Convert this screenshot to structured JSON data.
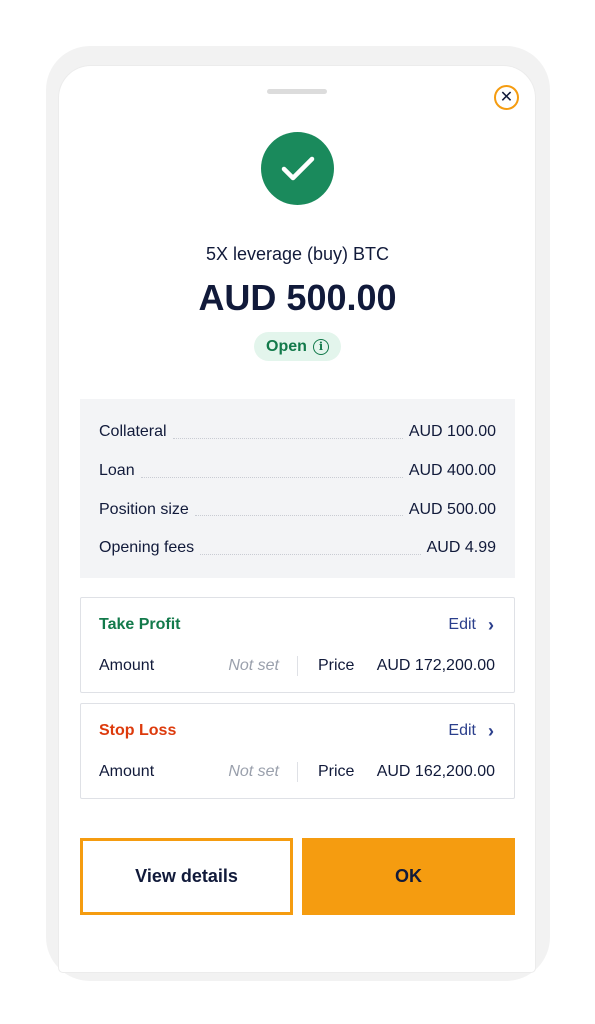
{
  "header": {
    "close_icon": "close-icon",
    "success_icon": "checkmark-icon"
  },
  "trade": {
    "subtitle": "5X leverage (buy) BTC",
    "amount": "AUD 500.00",
    "status": "Open",
    "status_icon": "info-icon"
  },
  "summary": {
    "rows": [
      {
        "label": "Collateral",
        "value": "AUD 100.00"
      },
      {
        "label": "Loan",
        "value": "AUD 400.00"
      },
      {
        "label": "Position size",
        "value": "AUD 500.00"
      },
      {
        "label": "Opening fees",
        "value": "AUD 4.99"
      }
    ]
  },
  "take_profit": {
    "title": "Take Profit",
    "edit_label": "Edit",
    "amount_label": "Amount",
    "amount_value": "Not set",
    "price_label": "Price",
    "price_value": "AUD 172,200.00"
  },
  "stop_loss": {
    "title": "Stop Loss",
    "edit_label": "Edit",
    "amount_label": "Amount",
    "amount_value": "Not set",
    "price_label": "Price",
    "price_value": "AUD 162,200.00"
  },
  "actions": {
    "view_details_label": "View details",
    "ok_label": "OK"
  },
  "colors": {
    "accent": "#f59c10",
    "success": "#1a8a5c",
    "take_profit": "#137a4b",
    "stop_loss": "#dd3a0c",
    "link": "#2b3f8c"
  }
}
